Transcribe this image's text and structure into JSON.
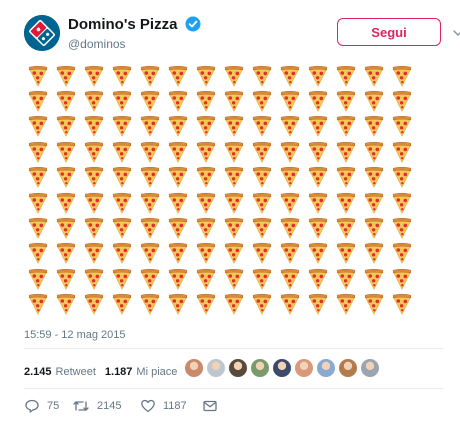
{
  "account": {
    "display_name": "Domino's Pizza",
    "handle": "@dominos",
    "verified_icon": "verified-badge-icon",
    "logo_icon": "dominos-logo-icon"
  },
  "follow_button": {
    "label": "Segui"
  },
  "tweet": {
    "emoji": "pizza-slice",
    "emoji_count": 140,
    "timestamp": "15:59 - 12 mag 2015"
  },
  "stats": {
    "retweets_count": "2.145",
    "retweets_label": "Retweet",
    "likes_count": "1.187",
    "likes_label": "Mi piace",
    "liker_avatar_count": 9
  },
  "actions": {
    "reply_count": "75",
    "retweet_count": "2145",
    "like_count": "1187"
  },
  "colors": {
    "brand_blue": "#006491",
    "brand_red": "#e31837",
    "follow_red": "#e0245e",
    "secondary_text": "#657786",
    "verified_blue": "#1da1f2"
  }
}
